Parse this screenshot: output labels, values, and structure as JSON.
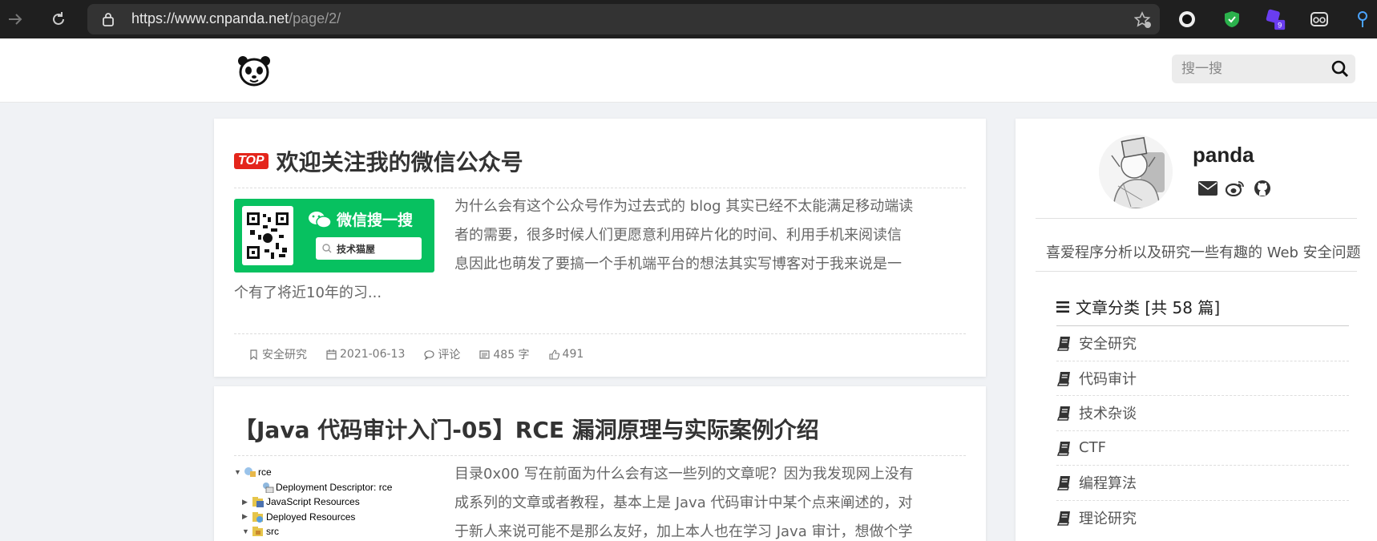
{
  "browser": {
    "url_host": "https://www.cnpanda.net",
    "url_path": "/page/2/",
    "extension_badge": "9"
  },
  "header": {
    "search_placeholder": "搜一搜"
  },
  "posts": [
    {
      "badge": "TOP",
      "title": "欢迎关注我的微信公众号",
      "thumb_title": "微信搜一搜",
      "thumb_search": "技术猫屋",
      "excerpt": "为什么会有这个公众号作为过去式的 blog 其实已经不太能满足移动端读者的需要，很多时候人们更愿意利用碎片化的时间、利用手机来阅读信息因此也萌发了要搞一个手机端平台的想法其实写博客对于我来说是一个有了将近10年的习...",
      "excerpt_lines": [
        "为什么会有这个公众号作为过去式的 blog 其实已经不太能满足移动端读",
        "者的需要，很多时候人们更愿意利用碎片化的时间、利用手机来阅读信",
        "息因此也萌发了要搞一个手机端平台的想法其实写博客对于我来说是一",
        "个有了将近10年的习..."
      ],
      "category": "安全研究",
      "date": "2021-06-13",
      "comments": "评论",
      "words": "485 字",
      "likes": "491"
    },
    {
      "title": "【Java 代码审计入门-05】RCE 漏洞原理与实际案例介绍",
      "excerpt_lines": [
        "目录0x00 写在前面为什么会有这一些列的文章呢？因为我发现网上没有",
        "成系列的文章或者教程，基本上是 Java 代码审计中某个点来阐述的，对",
        "于新人来说可能不是那么友好，加上本人也在学习 Java 审计，想做个学"
      ],
      "tree": [
        {
          "arrow": "▼",
          "indent": 0,
          "label": "rce"
        },
        {
          "arrow": "",
          "indent": 1,
          "label": "Deployment Descriptor: rce"
        },
        {
          "arrow": "▶",
          "indent": 1,
          "label": "JavaScript Resources"
        },
        {
          "arrow": "▶",
          "indent": 1,
          "label": "Deployed Resources"
        },
        {
          "arrow": "▼",
          "indent": 1,
          "label": "src"
        }
      ]
    }
  ],
  "sidebar": {
    "author": "panda",
    "bio": "喜爱程序分析以及研究一些有趣的 Web 安全问题",
    "categories_heading": "文章分类 [共 58 篇]",
    "categories": [
      "安全研究",
      "代码审计",
      "技术杂谈",
      "CTF",
      "编程算法",
      "理论研究"
    ]
  },
  "colors": {
    "top_badge": "#e4251b",
    "wechat_green": "#07c160"
  }
}
